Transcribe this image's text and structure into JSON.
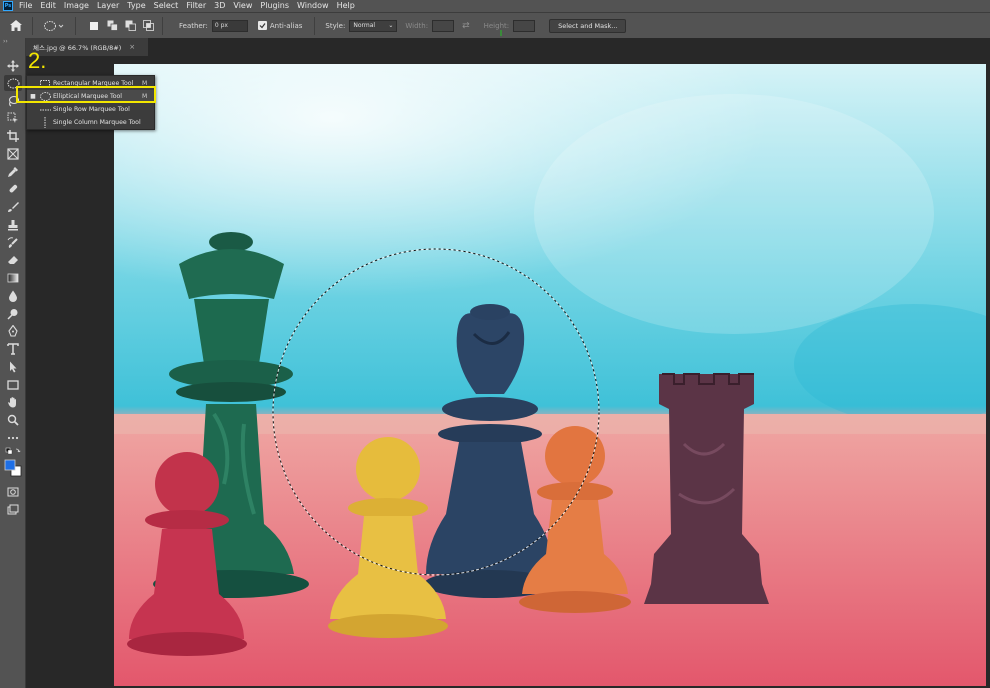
{
  "app": {
    "logo": "Ps"
  },
  "menu": [
    "File",
    "Edit",
    "Image",
    "Layer",
    "Type",
    "Select",
    "Filter",
    "3D",
    "View",
    "Plugins",
    "Window",
    "Help"
  ],
  "options": {
    "feather_label": "Feather:",
    "feather_value": "0 px",
    "antialias_label": "Anti-alias",
    "antialias_checked": true,
    "style_label": "Style:",
    "style_value": "Normal",
    "width_label": "Width:",
    "height_label": "Height:",
    "select_mask_label": "Select and Mask..."
  },
  "tab": {
    "title": "체스.jpg @ 66.7% (RGB/8#)",
    "close": "×"
  },
  "toolbox": {
    "grip": "››",
    "foreground_color": "#1e6fe6",
    "background_color": "#ffffff"
  },
  "flyout": {
    "items": [
      {
        "label": "Rectangular Marquee Tool",
        "shortcut": "M",
        "selected": false,
        "icon": "rect-marquee-icon"
      },
      {
        "label": "Elliptical Marquee Tool",
        "shortcut": "M",
        "selected": true,
        "bullet": "■",
        "icon": "ellipse-marquee-icon"
      },
      {
        "label": "Single Row Marquee Tool",
        "shortcut": "",
        "selected": false,
        "icon": "row-marquee-icon"
      },
      {
        "label": "Single Column Marquee Tool",
        "shortcut": "",
        "selected": false,
        "icon": "column-marquee-icon"
      }
    ]
  },
  "annotation": {
    "step": "2."
  },
  "colors": {
    "highlight": "#f2e600",
    "chrome": "#535353",
    "canvas_bg": "#282828"
  }
}
